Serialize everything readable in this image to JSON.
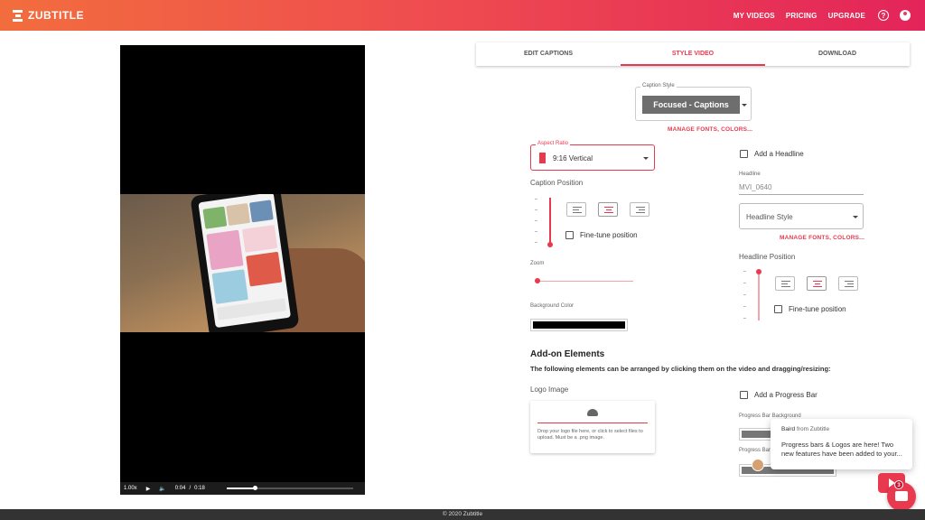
{
  "app": {
    "brand": "ZUBTITLE"
  },
  "nav": {
    "my_videos": "MY VIDEOS",
    "pricing": "PRICING",
    "upgrade": "UPGRADE",
    "help_glyph": "?"
  },
  "player": {
    "speed": "1.00x",
    "current_time": "0:04",
    "separator": "/",
    "duration": "0:18",
    "progress": 0.22
  },
  "tabs": [
    {
      "label": "EDIT CAPTIONS",
      "active": false
    },
    {
      "label": "STYLE VIDEO",
      "active": true
    },
    {
      "label": "DOWNLOAD",
      "active": false
    }
  ],
  "caption_style": {
    "legend": "Caption Style",
    "value": "Focused - Captions",
    "manage_link": "MANAGE FONTS, COLORS..."
  },
  "aspect_ratio": {
    "legend": "Aspect Ratio",
    "value": "9:16 Vertical"
  },
  "caption_position": {
    "label": "Caption Position",
    "fine_tune_label": "Fine-tune position",
    "fine_tune_checked": false
  },
  "zoom": {
    "label": "Zoom"
  },
  "background_color": {
    "label": "Background Color",
    "value": "#000000"
  },
  "headline": {
    "checkbox_label": "Add a Headline",
    "checked": false,
    "field_label": "Headline",
    "value": "MVI_0640",
    "style_placeholder": "Headline Style",
    "manage_link": "MANAGE FONTS, COLORS...",
    "position_label": "Headline Position",
    "fine_tune_label": "Fine-tune position"
  },
  "addons": {
    "title": "Add-on Elements",
    "description": "The following elements can be arranged by clicking them on the video and dragging/resizing:"
  },
  "logo": {
    "label": "Logo Image",
    "upload_text": "Drop your logo file here, or click to select files to upload. Must be a .png image."
  },
  "progress_bar": {
    "checkbox_label": "Add a Progress Bar",
    "background_label": "Progress Bar Background",
    "bar_label": "Progress Bar",
    "background_color": "#777777"
  },
  "chat": {
    "from_name": "Baird",
    "from_suffix": "from Zubtitle",
    "message": "Progress bars & Logos are here! Two new features have been added to your...",
    "badge_count": "3"
  },
  "footer": {
    "text": "© 2020 Zubtitle"
  },
  "colors": {
    "accent": "#e8394f",
    "topbar_start": "#f26d3d",
    "topbar_end": "#e3245a"
  }
}
